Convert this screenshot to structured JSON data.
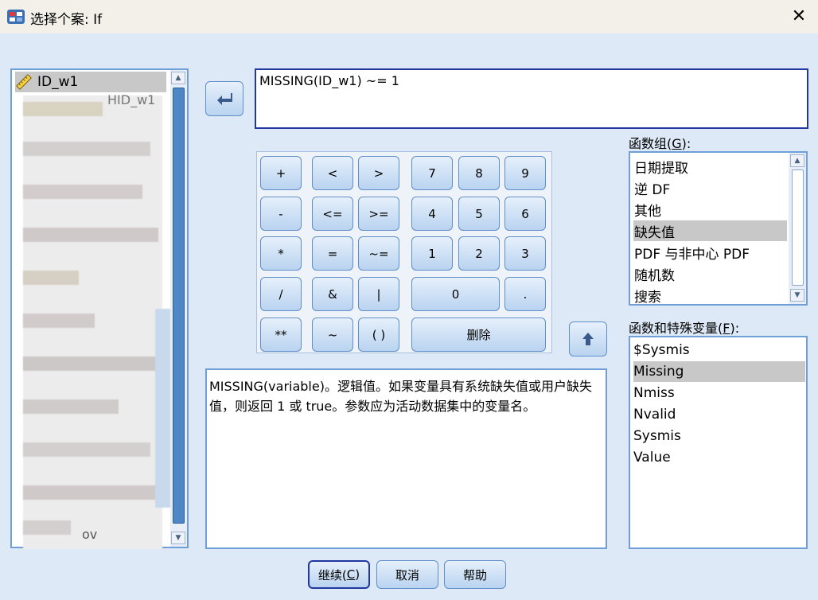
{
  "window": {
    "title": "选择个案: If",
    "close_glyph": "✕"
  },
  "variables": {
    "first": "ID_w1",
    "partial_visible": [
      "HID_w1",
      "ov"
    ]
  },
  "insert_arrow_glyph": "➜",
  "expression": "MISSING(ID_w1) ~= 1",
  "keypad": {
    "ops": [
      "+",
      "<",
      ">",
      "-",
      "<=",
      ">=",
      "*",
      "=",
      "~=",
      "/",
      "&",
      "|",
      "**",
      "~",
      "( )"
    ],
    "digits": [
      "7",
      "8",
      "9",
      "4",
      "5",
      "6",
      "1",
      "2",
      "3",
      "0",
      "."
    ],
    "delete": "删除"
  },
  "function_group": {
    "label_pre": "函数组(",
    "label_key": "G",
    "label_post": "):",
    "items": [
      "日期提取",
      "逆 DF",
      "其他",
      "缺失值",
      "PDF 与非中心 PDF",
      "随机数",
      "搜索"
    ],
    "selected": "缺失值"
  },
  "functions": {
    "label_pre": "函数和特殊变量(",
    "label_key": "F",
    "label_post": "):",
    "items": [
      "$Sysmis",
      "Missing",
      "Nmiss",
      "Nvalid",
      "Sysmis",
      "Value"
    ],
    "selected": "Missing"
  },
  "description": "MISSING(variable)。逻辑值。如果变量具有系统缺失值或用户缺失值，则返回 1 或 true。参数应为活动数据集中的变量名。",
  "buttons": {
    "continue_pre": "继续(",
    "continue_key": "C",
    "continue_post": ")",
    "cancel": "取消",
    "help": "帮助"
  },
  "colors": {
    "accent_border": "#2038a0",
    "panel_border": "#6f9fd6",
    "selection": "#c8c8c8",
    "button_top": "#e6f0fb",
    "button_bottom": "#b9d3f0"
  }
}
